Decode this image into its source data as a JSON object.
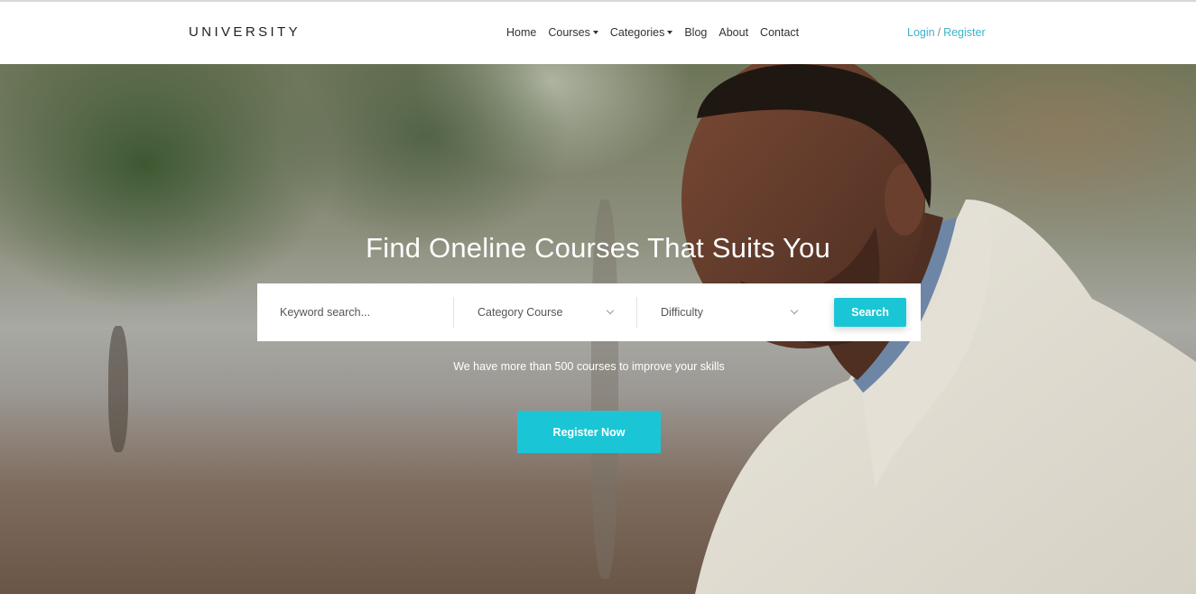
{
  "header": {
    "brand": "UNIVERSITY",
    "nav": [
      {
        "label": "Home",
        "dropdown": false
      },
      {
        "label": "Courses",
        "dropdown": true
      },
      {
        "label": "Categories",
        "dropdown": true
      },
      {
        "label": "Blog",
        "dropdown": false
      },
      {
        "label": "About",
        "dropdown": false
      },
      {
        "label": "Contact",
        "dropdown": false
      }
    ],
    "auth": {
      "login": "Login",
      "separator": "/",
      "register": "Register"
    }
  },
  "hero": {
    "title": "Find Oneline Courses That Suits You",
    "search": {
      "keyword_placeholder": "Keyword search...",
      "category_value": "Category Course",
      "difficulty_value": "Difficulty",
      "button_label": "Search"
    },
    "subtitle": "We have more than 500 courses to improve your skills",
    "cta_label": "Register Now"
  },
  "colors": {
    "accent": "#1ac6d6",
    "link": "#3bb4c9"
  }
}
